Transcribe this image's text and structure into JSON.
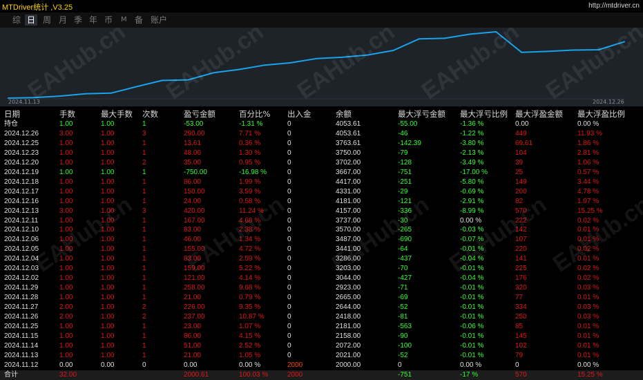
{
  "app": {
    "title": "MTDriver统计 ,V3.25",
    "url": "http://mtdriver.cn"
  },
  "tabs": [
    {
      "label": "综",
      "active": false
    },
    {
      "label": "日",
      "active": true
    },
    {
      "label": "周",
      "active": false
    },
    {
      "label": "月",
      "active": false
    },
    {
      "label": "季",
      "active": false
    },
    {
      "label": "年",
      "active": false
    },
    {
      "label": "币",
      "active": false
    },
    {
      "label": "M",
      "active": false
    },
    {
      "label": "备",
      "active": false
    },
    {
      "label": "账户",
      "active": false
    }
  ],
  "chart_data": {
    "type": "line",
    "title": "",
    "x_start_label": "2024.11.13",
    "x_end_label": "2024.12.26",
    "x": [
      "2024.11.12",
      "2024.11.13",
      "2024.11.14",
      "2024.11.15",
      "2024.11.25",
      "2024.11.26",
      "2024.11.27",
      "2024.11.28",
      "2024.11.29",
      "2024.12.02",
      "2024.12.03",
      "2024.12.04",
      "2024.12.05",
      "2024.12.06",
      "2024.12.10",
      "2024.12.11",
      "2024.12.13",
      "2024.12.16",
      "2024.12.17",
      "2024.12.18",
      "2024.12.19",
      "2024.12.20",
      "2024.12.23",
      "2024.12.25",
      "2024.12.26"
    ],
    "values": [
      2000.0,
      2021.0,
      2072.0,
      2158.0,
      2181.0,
      2418.0,
      2644.0,
      2665.0,
      2923.0,
      3044.0,
      3203.0,
      3286.0,
      3441.0,
      3487.0,
      3570.0,
      3737.0,
      4157.0,
      4181.0,
      4331.0,
      4417.0,
      3667.0,
      3702.0,
      3750.0,
      3763.61,
      4053.61
    ],
    "line_color": "#1aa3e8",
    "grid": false
  },
  "table": {
    "headers": [
      "日期",
      "手数",
      "最大手数",
      "次数",
      "盈亏金额",
      "百分比%",
      "出入金",
      "余额",
      "最大浮亏金额",
      "最大浮亏比例",
      "最大浮盈金额",
      "最大浮盈比例"
    ],
    "rows": [
      {
        "c": [
          "持仓",
          "1.00",
          "1.00",
          "1",
          "-53.00",
          "-1.31 %",
          "0",
          "4053.61",
          "-55.00",
          "-1.36 %",
          "0.00",
          "0.00 %"
        ],
        "k": [
          "w",
          "g",
          "g",
          "g",
          "g",
          "g",
          "w",
          "w",
          "g",
          "g",
          "w",
          "w"
        ]
      },
      {
        "c": [
          "2024.12.26",
          "3.00",
          "1.00",
          "3",
          "290.00",
          "7.71 %",
          "0",
          "4053.61",
          "-46",
          "-1.22 %",
          "449",
          "11.93 %"
        ],
        "k": [
          "w",
          "r",
          "r",
          "r",
          "r",
          "r",
          "w",
          "w",
          "g",
          "g",
          "r",
          "r"
        ]
      },
      {
        "c": [
          "2024.12.25",
          "1.00",
          "1.00",
          "1",
          "13.61",
          "0.36 %",
          "0",
          "3763.61",
          "-142.39",
          "-3.80 %",
          "69.61",
          "1.86 %"
        ],
        "k": [
          "w",
          "r",
          "r",
          "r",
          "r",
          "r",
          "w",
          "w",
          "g",
          "g",
          "r",
          "r"
        ]
      },
      {
        "c": [
          "2024.12.23",
          "1.00",
          "1.00",
          "1",
          "48.00",
          "1.30 %",
          "0",
          "3750.00",
          "-79",
          "-2.13 %",
          "104",
          "2.81 %"
        ],
        "k": [
          "w",
          "r",
          "r",
          "r",
          "r",
          "r",
          "w",
          "w",
          "g",
          "g",
          "r",
          "r"
        ]
      },
      {
        "c": [
          "2024.12.20",
          "1.00",
          "1.00",
          "2",
          "35.00",
          "0.95 %",
          "0",
          "3702.00",
          "-128",
          "-3.49 %",
          "39",
          "1.06 %"
        ],
        "k": [
          "w",
          "r",
          "r",
          "r",
          "r",
          "r",
          "w",
          "w",
          "g",
          "g",
          "r",
          "r"
        ]
      },
      {
        "c": [
          "2024.12.19",
          "1.00",
          "1.00",
          "1",
          "-750.00",
          "-16.98 %",
          "0",
          "3667.00",
          "-751",
          "-17.00 %",
          "25",
          "0.57 %"
        ],
        "k": [
          "w",
          "g",
          "g",
          "g",
          "g",
          "g",
          "w",
          "w",
          "g",
          "g",
          "r",
          "r"
        ]
      },
      {
        "c": [
          "2024.12.18",
          "1.00",
          "1.00",
          "1",
          "86.00",
          "1.99 %",
          "0",
          "4417.00",
          "-251",
          "-5.80 %",
          "149",
          "3.44 %"
        ],
        "k": [
          "w",
          "r",
          "r",
          "r",
          "r",
          "r",
          "w",
          "w",
          "g",
          "g",
          "r",
          "r"
        ]
      },
      {
        "c": [
          "2024.12.17",
          "1.00",
          "1.00",
          "1",
          "150.00",
          "3.59 %",
          "0",
          "4331.00",
          "-29",
          "-0.69 %",
          "200",
          "4.78 %"
        ],
        "k": [
          "w",
          "r",
          "r",
          "r",
          "r",
          "r",
          "w",
          "w",
          "g",
          "g",
          "r",
          "r"
        ]
      },
      {
        "c": [
          "2024.12.16",
          "1.00",
          "1.00",
          "1",
          "24.00",
          "0.58 %",
          "0",
          "4181.00",
          "-121",
          "-2.91 %",
          "82",
          "1.97 %"
        ],
        "k": [
          "w",
          "r",
          "r",
          "r",
          "r",
          "r",
          "w",
          "w",
          "g",
          "g",
          "r",
          "r"
        ]
      },
      {
        "c": [
          "2024.12.13",
          "3.00",
          "1.00",
          "3",
          "420.00",
          "11.24 %",
          "0",
          "4157.00",
          "-336",
          "-8.99 %",
          "570",
          "15.25 %"
        ],
        "k": [
          "w",
          "r",
          "r",
          "r",
          "r",
          "r",
          "w",
          "w",
          "g",
          "g",
          "r",
          "r"
        ]
      },
      {
        "c": [
          "2024.12.11",
          "1.00",
          "1.00",
          "1",
          "167.00",
          "4.68 %",
          "0",
          "3737.00",
          "-30",
          "0.00 %",
          "222",
          "0.02 %"
        ],
        "k": [
          "w",
          "r",
          "r",
          "r",
          "r",
          "r",
          "w",
          "w",
          "g",
          "w",
          "r",
          "r"
        ]
      },
      {
        "c": [
          "2024.12.10",
          "1.00",
          "1.00",
          "1",
          "83.00",
          "2.38 %",
          "0",
          "3570.00",
          "-265",
          "-0.03 %",
          "142",
          "0.01 %"
        ],
        "k": [
          "w",
          "r",
          "r",
          "r",
          "r",
          "r",
          "w",
          "w",
          "g",
          "g",
          "r",
          "r"
        ]
      },
      {
        "c": [
          "2024.12.06",
          "1.00",
          "1.00",
          "1",
          "46.00",
          "1.34 %",
          "0",
          "3487.00",
          "-690",
          "-0.07 %",
          "107",
          "0.01 %"
        ],
        "k": [
          "w",
          "r",
          "r",
          "r",
          "r",
          "r",
          "w",
          "w",
          "g",
          "g",
          "r",
          "r"
        ]
      },
      {
        "c": [
          "2024.12.05",
          "1.00",
          "1.00",
          "1",
          "155.00",
          "4.72 %",
          "0",
          "3441.00",
          "-64",
          "-0.01 %",
          "220",
          "0.02 %"
        ],
        "k": [
          "w",
          "r",
          "r",
          "r",
          "r",
          "r",
          "w",
          "w",
          "g",
          "g",
          "r",
          "r"
        ]
      },
      {
        "c": [
          "2024.12.04",
          "1.00",
          "1.00",
          "1",
          "83.00",
          "2.59 %",
          "0",
          "3286.00",
          "-437",
          "-0.04 %",
          "141",
          "0.01 %"
        ],
        "k": [
          "w",
          "r",
          "r",
          "r",
          "r",
          "r",
          "w",
          "w",
          "g",
          "g",
          "r",
          "r"
        ]
      },
      {
        "c": [
          "2024.12.03",
          "1.00",
          "1.00",
          "1",
          "159.00",
          "5.22 %",
          "0",
          "3203.00",
          "-70",
          "-0.01 %",
          "225",
          "0.02 %"
        ],
        "k": [
          "w",
          "r",
          "r",
          "r",
          "r",
          "r",
          "w",
          "w",
          "g",
          "g",
          "r",
          "r"
        ]
      },
      {
        "c": [
          "2024.12.02",
          "1.00",
          "1.00",
          "1",
          "121.00",
          "4.14 %",
          "0",
          "3044.00",
          "-427",
          "-0.04 %",
          "176",
          "0.02 %"
        ],
        "k": [
          "w",
          "r",
          "r",
          "r",
          "r",
          "r",
          "w",
          "w",
          "g",
          "g",
          "r",
          "r"
        ]
      },
      {
        "c": [
          "2024.11.29",
          "1.00",
          "1.00",
          "1",
          "258.00",
          "9.68 %",
          "0",
          "2923.00",
          "-71",
          "-0.01 %",
          "320",
          "0.03 %"
        ],
        "k": [
          "w",
          "r",
          "r",
          "r",
          "r",
          "r",
          "w",
          "w",
          "g",
          "g",
          "r",
          "r"
        ]
      },
      {
        "c": [
          "2024.11.28",
          "1.00",
          "1.00",
          "1",
          "21.00",
          "0.79 %",
          "0",
          "2665.00",
          "-69",
          "-0.01 %",
          "77",
          "0.01 %"
        ],
        "k": [
          "w",
          "r",
          "r",
          "r",
          "r",
          "r",
          "w",
          "w",
          "g",
          "g",
          "r",
          "r"
        ]
      },
      {
        "c": [
          "2024.11.27",
          "2.00",
          "1.00",
          "2",
          "226.00",
          "9.35 %",
          "0",
          "2644.00",
          "-52",
          "-0.01 %",
          "334",
          "0.03 %"
        ],
        "k": [
          "w",
          "r",
          "r",
          "r",
          "r",
          "r",
          "w",
          "w",
          "g",
          "g",
          "r",
          "r"
        ]
      },
      {
        "c": [
          "2024.11.26",
          "2.00",
          "1.00",
          "2",
          "237.00",
          "10.87 %",
          "0",
          "2418.00",
          "-81",
          "-0.01 %",
          "250",
          "0.03 %"
        ],
        "k": [
          "w",
          "r",
          "r",
          "r",
          "r",
          "r",
          "w",
          "w",
          "g",
          "g",
          "r",
          "r"
        ]
      },
      {
        "c": [
          "2024.11.25",
          "1.00",
          "1.00",
          "1",
          "23.00",
          "1.07 %",
          "0",
          "2181.00",
          "-563",
          "-0.06 %",
          "85",
          "0.01 %"
        ],
        "k": [
          "w",
          "r",
          "r",
          "r",
          "r",
          "r",
          "w",
          "w",
          "g",
          "g",
          "r",
          "r"
        ]
      },
      {
        "c": [
          "2024.11.15",
          "1.00",
          "1.00",
          "1",
          "86.00",
          "4.15 %",
          "0",
          "2158.00",
          "-90",
          "-0.01 %",
          "145",
          "0.01 %"
        ],
        "k": [
          "w",
          "r",
          "r",
          "r",
          "r",
          "r",
          "w",
          "w",
          "g",
          "g",
          "r",
          "r"
        ]
      },
      {
        "c": [
          "2024.11.14",
          "1.00",
          "1.00",
          "1",
          "51.00",
          "2.52 %",
          "0",
          "2072.00",
          "-100",
          "-0.01 %",
          "102",
          "0.01 %"
        ],
        "k": [
          "w",
          "r",
          "r",
          "r",
          "r",
          "r",
          "w",
          "w",
          "g",
          "g",
          "r",
          "r"
        ]
      },
      {
        "c": [
          "2024.11.13",
          "1.00",
          "1.00",
          "1",
          "21.00",
          "1.05 %",
          "0",
          "2021.00",
          "-52",
          "-0.01 %",
          "79",
          "0.01 %"
        ],
        "k": [
          "w",
          "r",
          "r",
          "r",
          "r",
          "r",
          "w",
          "w",
          "g",
          "g",
          "r",
          "r"
        ]
      },
      {
        "c": [
          "2024.11.12",
          "0.00",
          "0.00",
          "0",
          "0.00",
          "0.00 %",
          "2000",
          "2000.00",
          "0",
          "0.00 %",
          "0",
          "0.00 %"
        ],
        "k": [
          "w",
          "w",
          "w",
          "w",
          "w",
          "w",
          "o",
          "w",
          "w",
          "w",
          "w",
          "w"
        ]
      },
      {
        "c": [
          "合计",
          "32.00",
          "",
          "",
          "2000.61",
          "100.03 %",
          "2000",
          "",
          "-751",
          "-17 %",
          "570",
          "15.25 %"
        ],
        "k": [
          "w",
          "r",
          "w",
          "w",
          "r",
          "r",
          "r",
          "w",
          "g",
          "g",
          "r",
          "r"
        ],
        "total": true
      }
    ]
  },
  "watermark": "EAHub.cn",
  "colors": {
    "profit": "#e01818",
    "loss": "#34ff34",
    "neutral": "#e0e0e0",
    "deposit": "#ff4000",
    "title": "#ffd400",
    "chart_bg": "#1d2329"
  }
}
